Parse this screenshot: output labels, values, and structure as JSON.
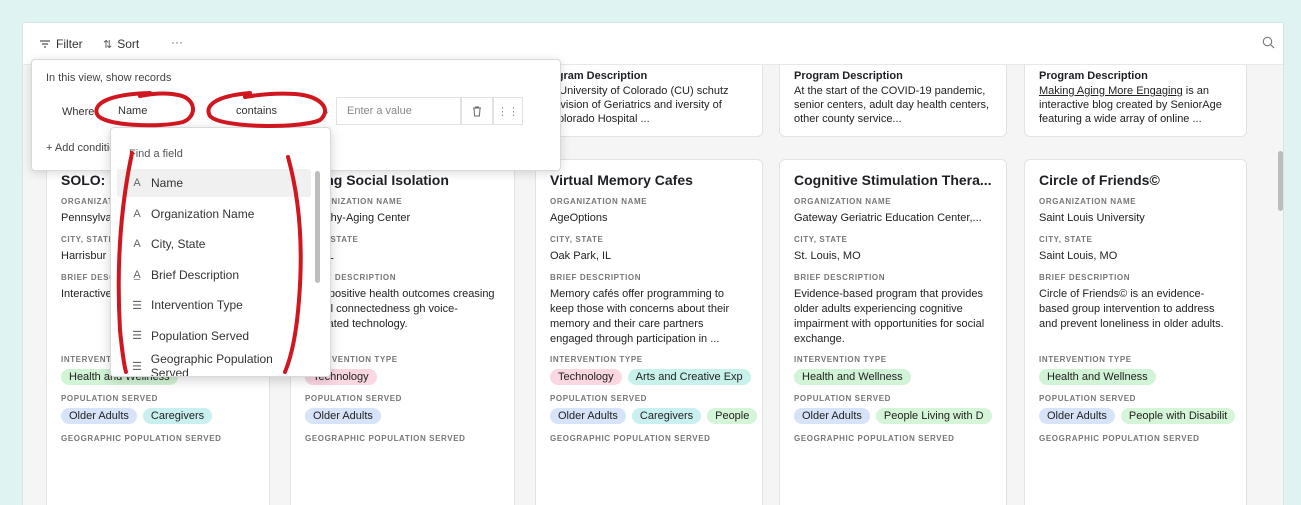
{
  "toolbar": {
    "filter_label": "Filter",
    "sort_label": "Sort",
    "more_label": "···"
  },
  "filter_popover": {
    "title": "In this view, show records",
    "where_label": "Where",
    "field_value": "Name",
    "operator_value": "contains",
    "value_placeholder": "Enter a value",
    "add_condition_label": "+ Add condition"
  },
  "field_dropdown": {
    "search_placeholder": "Find a field",
    "items": [
      {
        "icon": "A",
        "label": "Name"
      },
      {
        "icon": "A",
        "label": "Organization Name"
      },
      {
        "icon": "A",
        "label": "City, State"
      },
      {
        "icon": "A̲",
        "label": "Brief Description"
      },
      {
        "icon": "☰",
        "label": "Intervention Type"
      },
      {
        "icon": "☰",
        "label": "Population Served"
      },
      {
        "icon": "☰",
        "label": "Geographic Population Served"
      }
    ]
  },
  "labels": {
    "org": "ORGANIZATION NAME",
    "city": "CITY, STATE",
    "brief": "BRIEF DESCRIPTION",
    "intervention": "INTERVENTION TYPE",
    "population": "POPULATION SERVED",
    "geo": "GEOGRAPHIC POPULATION SERVED",
    "program_desc": "Program Description"
  },
  "top_cards": [
    {
      "desc_title": "ogram Description",
      "desc": "e University of Colorado (CU) schutz Division of Geriatrics and iversity of Colorado Hospital ..."
    },
    {
      "desc_title": "Program Description",
      "desc": "At the start of the COVID-19 pandemic, senior centers, adult day health centers, other county service..."
    },
    {
      "desc_title": "Program Description",
      "desc_link": "Making Aging More Engaging",
      "desc": " is an interactive blog created by SeniorAge featuring a wide array of online ..."
    }
  ],
  "cards": [
    {
      "title": "SOLO: S",
      "org": "Pennsylva",
      "city": "Harrisbur",
      "brief": "Interactive peer-led s isolation.",
      "interventions": [
        "Health and Wellness"
      ],
      "populations": [
        "Older Adults",
        "Caregivers"
      ]
    },
    {
      "title": "ucing Social Isolation",
      "org": "Healthy-Aging Center",
      "city": "ille, IL",
      "brief": "otes positive health outcomes creasing social connectedness gh voice-activated technology.",
      "interventions": [
        "Technology"
      ],
      "populations": [
        "Older Adults"
      ]
    },
    {
      "title": "Virtual Memory Cafes",
      "org": "AgeOptions",
      "city": "Oak Park, IL",
      "brief": "Memory cafés offer programming to keep those with concerns about their memory and their care partners engaged through participation in ...",
      "interventions": [
        "Technology",
        "Arts and Creative Exp"
      ],
      "populations": [
        "Older Adults",
        "Caregivers",
        "People"
      ]
    },
    {
      "title": "Cognitive Stimulation Thera...",
      "org": "Gateway Geriatric Education Center,...",
      "city": "St. Louis, MO",
      "brief": "Evidence-based program that provides older adults experiencing cognitive impairment with opportunities for social exchange.",
      "interventions": [
        "Health and Wellness"
      ],
      "populations": [
        "Older Adults",
        "People Living with D"
      ]
    },
    {
      "title": "Circle of Friends©",
      "org": "Saint Louis University",
      "city": "Saint Louis, MO",
      "brief": "Circle of Friends© is an evidence-based group intervention to address and prevent loneliness in older adults.",
      "interventions": [
        "Health and Wellness"
      ],
      "populations": [
        "Older Adults",
        "People with Disabilit"
      ]
    }
  ],
  "colors": {
    "health": "#d1f3d6",
    "technology": "#fbd7e2",
    "arts": "#c8f1ec",
    "older_adults": "#d6e3f9",
    "caregivers": "#c9f0ef",
    "people": "#d4f5d8",
    "annotation": "#d0161e"
  }
}
